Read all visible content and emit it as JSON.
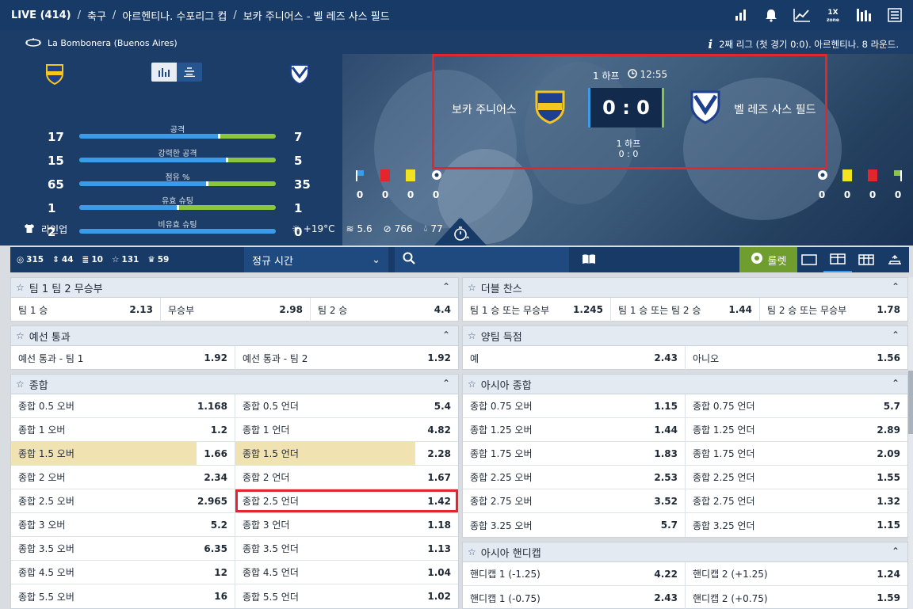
{
  "breadcrumb": {
    "live": "LIVE (414)",
    "sport": "축구",
    "league": "아르헨티나. 수포리그 컵",
    "match": "보카 주니어스 - 벨 레즈 사스 필드"
  },
  "header_icons": [
    "bar-chart-icon",
    "bell-icon",
    "trend-chart-icon",
    "1x-zone-icon",
    "stats-icon",
    "list-icon"
  ],
  "onex_zone": "1X\nzone",
  "venue": "La Bombonera (Buenos Aires)",
  "round_info": "2째 리그 (첫 경기 0:0). 아르헨티나. 8 라운드.",
  "stats": [
    {
      "label": "공격",
      "home": "17",
      "away": "7",
      "home_share": 0.71
    },
    {
      "label": "강력한 공격",
      "home": "15",
      "away": "5",
      "home_share": 0.75
    },
    {
      "label": "점유 %",
      "home": "65",
      "away": "35",
      "home_share": 0.65
    },
    {
      "label": "유효 슈팅",
      "home": "1",
      "away": "1",
      "home_share": 0.5
    },
    {
      "label": "비유효 슈팅",
      "home": "2",
      "away": "0",
      "home_share": 1.0
    }
  ],
  "lineup_label": "라인업",
  "weather": {
    "temp": "+19°C",
    "wind": "5.6",
    "pressure": "766",
    "humidity": "77"
  },
  "scoreboard": {
    "period": "1 하프",
    "clock": "12:55",
    "home": "보카 주니어스",
    "away": "벨 레즈 사스 필드",
    "score": "0 : 0",
    "half_label": "1 하프",
    "half_score": "0 : 0"
  },
  "cards_home": [
    "0",
    "0",
    "0",
    "0"
  ],
  "cards_away": [
    "0",
    "0",
    "0",
    "0"
  ],
  "toolbar": {
    "counts": [
      "315",
      "44",
      "10",
      "131",
      "59"
    ],
    "period_select": "정규 시간",
    "roulette": "룰렛"
  },
  "markets_left": [
    {
      "title": "팀 1 팀 2 무승부",
      "rows": [
        [
          [
            "팀 1 승",
            "2.13"
          ],
          [
            "무승부",
            "2.98"
          ],
          [
            "팀 2 승",
            "4.4"
          ]
        ]
      ]
    },
    {
      "title": "예선 통과",
      "rows": [
        [
          [
            "예선 통과 - 팀 1",
            "1.92"
          ],
          [
            "예선 통과 - 팀 2",
            "1.92"
          ]
        ]
      ]
    },
    {
      "title": "종합",
      "rows": [
        [
          [
            "종합 0.5 오버",
            "1.168"
          ],
          [
            "종합 0.5 언더",
            "5.4"
          ]
        ],
        [
          [
            "종합 1 오버",
            "1.2"
          ],
          [
            "종합 1 언더",
            "4.82"
          ]
        ],
        [
          [
            "종합 1.5 오버",
            "1.66"
          ],
          [
            "종합 1.5 언더",
            "2.28"
          ]
        ],
        [
          [
            "종합 2 오버",
            "2.34"
          ],
          [
            "종합 2 언더",
            "1.67"
          ]
        ],
        [
          [
            "종합 2.5 오버",
            "2.965"
          ],
          [
            "종합 2.5 언더",
            "1.42"
          ]
        ],
        [
          [
            "종합 3 오버",
            "5.2"
          ],
          [
            "종합 3 언더",
            "1.18"
          ]
        ],
        [
          [
            "종합 3.5 오버",
            "6.35"
          ],
          [
            "종합 3.5 언더",
            "1.13"
          ]
        ],
        [
          [
            "종합 4.5 오버",
            "12"
          ],
          [
            "종합 4.5 언더",
            "1.04"
          ]
        ],
        [
          [
            "종합 5.5 오버",
            "16"
          ],
          [
            "종합 5.5 언더",
            "1.02"
          ]
        ]
      ]
    }
  ],
  "markets_right": [
    {
      "title": "더블 찬스",
      "rows": [
        [
          [
            "팀 1 승 또는 무승부",
            "1.245"
          ],
          [
            "팀 1 승 또는 팀 2 승",
            "1.44"
          ],
          [
            "팀 2 승 또는 무승부",
            "1.78"
          ]
        ]
      ]
    },
    {
      "title": "양팀 득점",
      "rows": [
        [
          [
            "예",
            "2.43"
          ],
          [
            "아니오",
            "1.56"
          ]
        ]
      ]
    },
    {
      "title": "아시아 종합",
      "rows": [
        [
          [
            "종합 0.75 오버",
            "1.15"
          ],
          [
            "종합 0.75 언더",
            "5.7"
          ]
        ],
        [
          [
            "종합 1.25 오버",
            "1.44"
          ],
          [
            "종합 1.25 언더",
            "2.89"
          ]
        ],
        [
          [
            "종합 1.75 오버",
            "1.83"
          ],
          [
            "종합 1.75 언더",
            "2.09"
          ]
        ],
        [
          [
            "종합 2.25 오버",
            "2.53"
          ],
          [
            "종합 2.25 언더",
            "1.55"
          ]
        ],
        [
          [
            "종합 2.75 오버",
            "3.52"
          ],
          [
            "종합 2.75 언더",
            "1.32"
          ]
        ],
        [
          [
            "종합 3.25 오버",
            "5.7"
          ],
          [
            "종합 3.25 언더",
            "1.15"
          ]
        ]
      ]
    },
    {
      "title": "아시아 핸디캡",
      "rows": [
        [
          [
            "핸디캡 1 (-1.25)",
            "4.22"
          ],
          [
            "핸디캡 2 (+1.25)",
            "1.24"
          ]
        ],
        [
          [
            "핸디캡 1 (-0.75)",
            "2.43"
          ],
          [
            "핸디캡 2 (+0.75)",
            "1.59"
          ]
        ]
      ]
    }
  ],
  "colors": {
    "navy": "#173a66",
    "home_bar": "#3a9be8",
    "away_bar": "#8cc63f",
    "highlight": "#f1e3b1",
    "annotation": "#e3262e"
  }
}
